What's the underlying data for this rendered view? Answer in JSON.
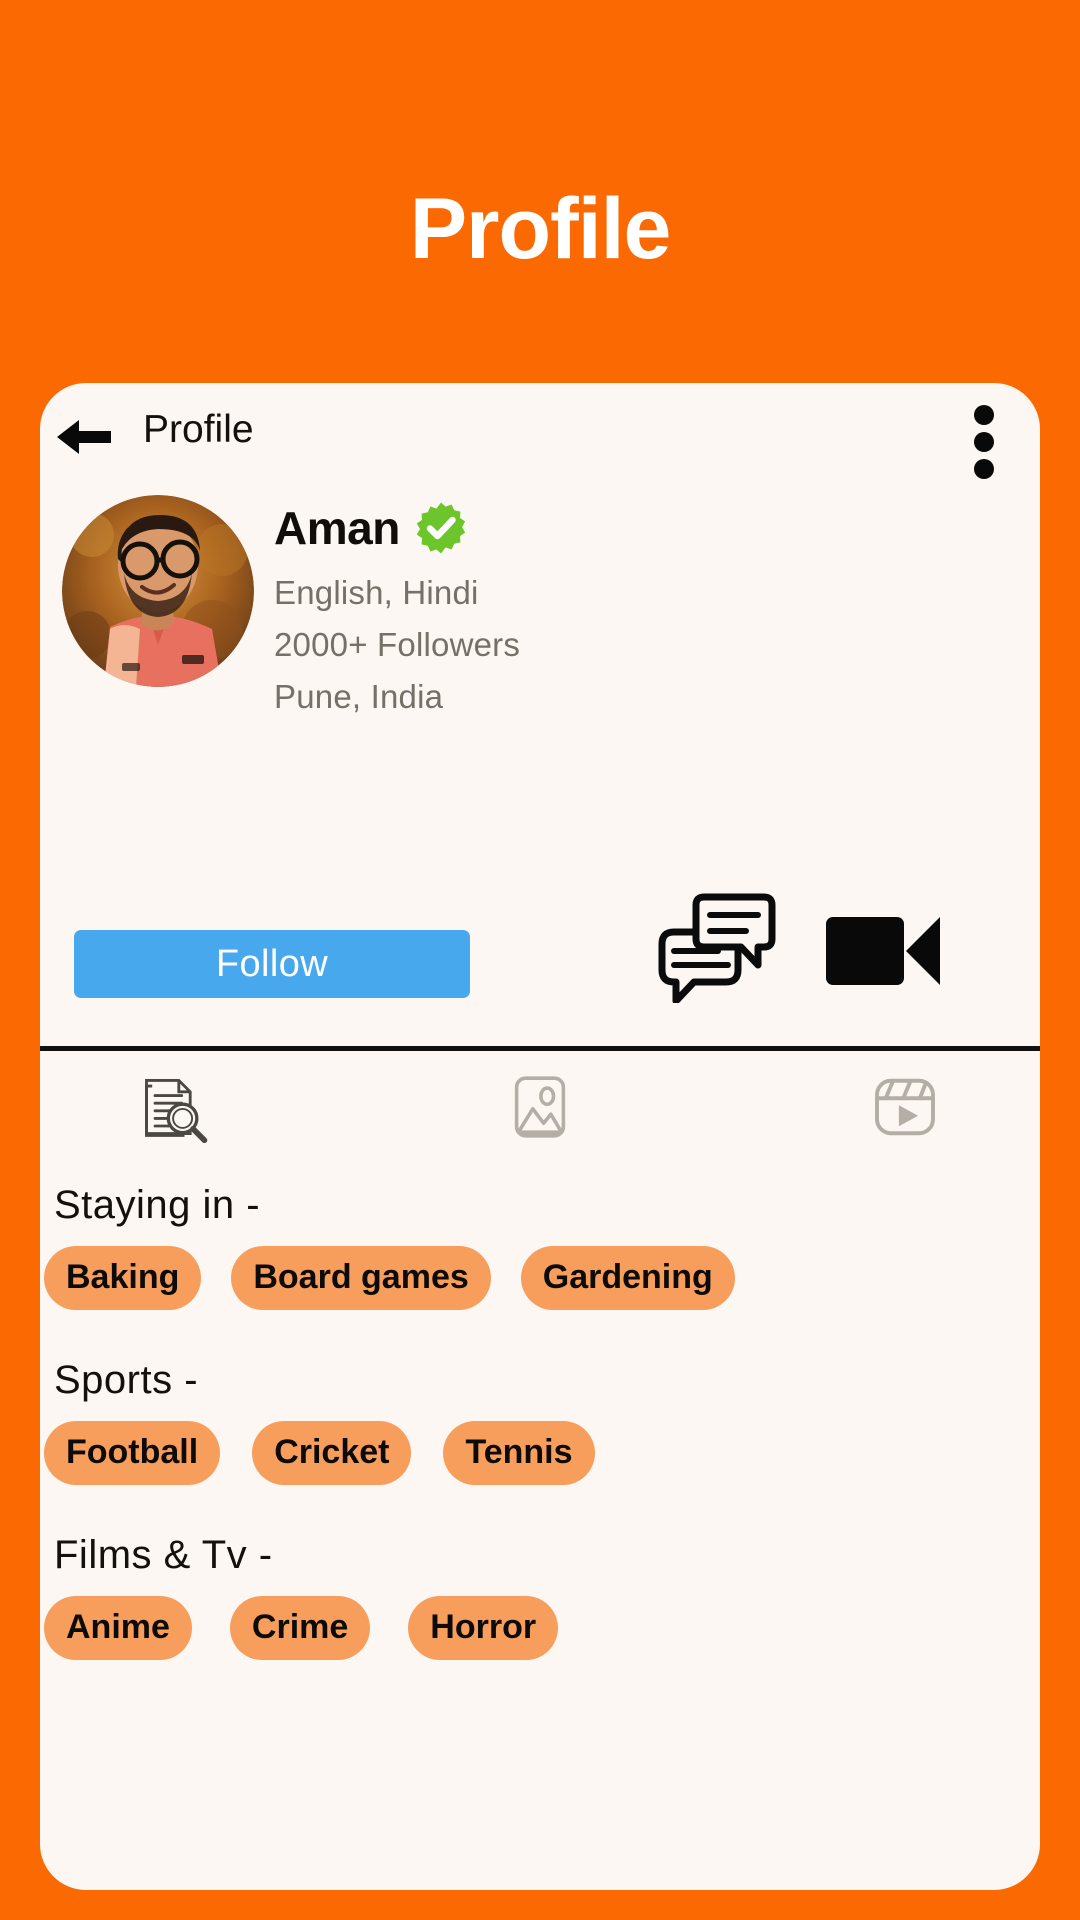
{
  "page": {
    "title": "Profile",
    "background_color": "#FB6A02",
    "card_color": "#FCF7F2"
  },
  "appbar": {
    "back_icon": "back-arrow-icon",
    "title": "Profile",
    "menu_icon": "kebab-menu-icon"
  },
  "profile": {
    "avatar_alt": "user-avatar",
    "name": "Aman",
    "verified_icon": "verified-badge-icon",
    "verified_color": "#6CC62B",
    "languages": "English, Hindi",
    "followers": "2000+  Followers",
    "location": "Pune, India"
  },
  "actions": {
    "follow_label": "Follow",
    "follow_color": "#47A8EE",
    "chat_icon": "chat-bubbles-icon",
    "video_icon": "video-camera-icon"
  },
  "tabs": [
    {
      "name": "posts-tab",
      "icon": "document-search-icon",
      "active": true
    },
    {
      "name": "photos-tab",
      "icon": "image-icon",
      "active": false
    },
    {
      "name": "reels-tab",
      "icon": "video-reel-icon",
      "active": false
    }
  ],
  "interests": {
    "pill_color": "#F79E5C",
    "sections": [
      {
        "heading": "Staying in -",
        "tags": [
          "Baking",
          "Board games",
          "Gardening"
        ]
      },
      {
        "heading": "Sports -",
        "tags": [
          "Football",
          "Cricket",
          "Tennis"
        ]
      },
      {
        "heading": "Films & Tv -",
        "tags": [
          "Anime",
          "Crime",
          "Horror"
        ]
      }
    ]
  }
}
